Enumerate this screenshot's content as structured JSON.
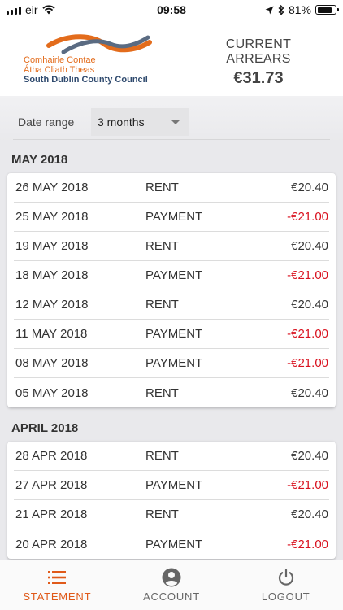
{
  "status_bar": {
    "carrier": "eir",
    "time": "09:58",
    "battery": "81%",
    "battery_level": 0.81,
    "icons": [
      "signal-icon",
      "wifi-icon",
      "location-arrow-icon",
      "bluetooth-icon",
      "battery-icon"
    ]
  },
  "header": {
    "logo": {
      "line1": "Comhairle Contae",
      "line2": "Átha Cliath Theas",
      "line3": "South Dublin County Council"
    },
    "arrears_label": "CURRENT ARREARS",
    "arrears_value": "€31.73"
  },
  "filter": {
    "label": "Date range",
    "value": "3 months"
  },
  "months": [
    {
      "title": "MAY 2018",
      "rows": [
        {
          "date": "26 MAY 2018",
          "type": "RENT",
          "amount": "€20.40",
          "negative": false
        },
        {
          "date": "25 MAY 2018",
          "type": "PAYMENT",
          "amount": "-€21.00",
          "negative": true
        },
        {
          "date": "19 MAY 2018",
          "type": "RENT",
          "amount": "€20.40",
          "negative": false
        },
        {
          "date": "18 MAY 2018",
          "type": "PAYMENT",
          "amount": "-€21.00",
          "negative": true
        },
        {
          "date": "12 MAY 2018",
          "type": "RENT",
          "amount": "€20.40",
          "negative": false
        },
        {
          "date": "11 MAY 2018",
          "type": "PAYMENT",
          "amount": "-€21.00",
          "negative": true
        },
        {
          "date": "08 MAY 2018",
          "type": "PAYMENT",
          "amount": "-€21.00",
          "negative": true
        },
        {
          "date": "05 MAY 2018",
          "type": "RENT",
          "amount": "€20.40",
          "negative": false
        }
      ]
    },
    {
      "title": "APRIL 2018",
      "rows": [
        {
          "date": "28 APR 2018",
          "type": "RENT",
          "amount": "€20.40",
          "negative": false
        },
        {
          "date": "27 APR 2018",
          "type": "PAYMENT",
          "amount": "-€21.00",
          "negative": true
        },
        {
          "date": "21 APR 2018",
          "type": "RENT",
          "amount": "€20.40",
          "negative": false
        },
        {
          "date": "20 APR 2018",
          "type": "PAYMENT",
          "amount": "-€21.00",
          "negative": true
        }
      ]
    }
  ],
  "bottom_nav": [
    {
      "label": "STATEMENT",
      "icon": "list-icon",
      "active": true
    },
    {
      "label": "ACCOUNT",
      "icon": "account-circle-icon",
      "active": false
    },
    {
      "label": "LOGOUT",
      "icon": "power-icon",
      "active": false
    }
  ],
  "colors": {
    "accent": "#e05a1a",
    "negative": "#d9121f",
    "logo_orange": "#e36c1c",
    "logo_navy": "#2f4a6e"
  }
}
